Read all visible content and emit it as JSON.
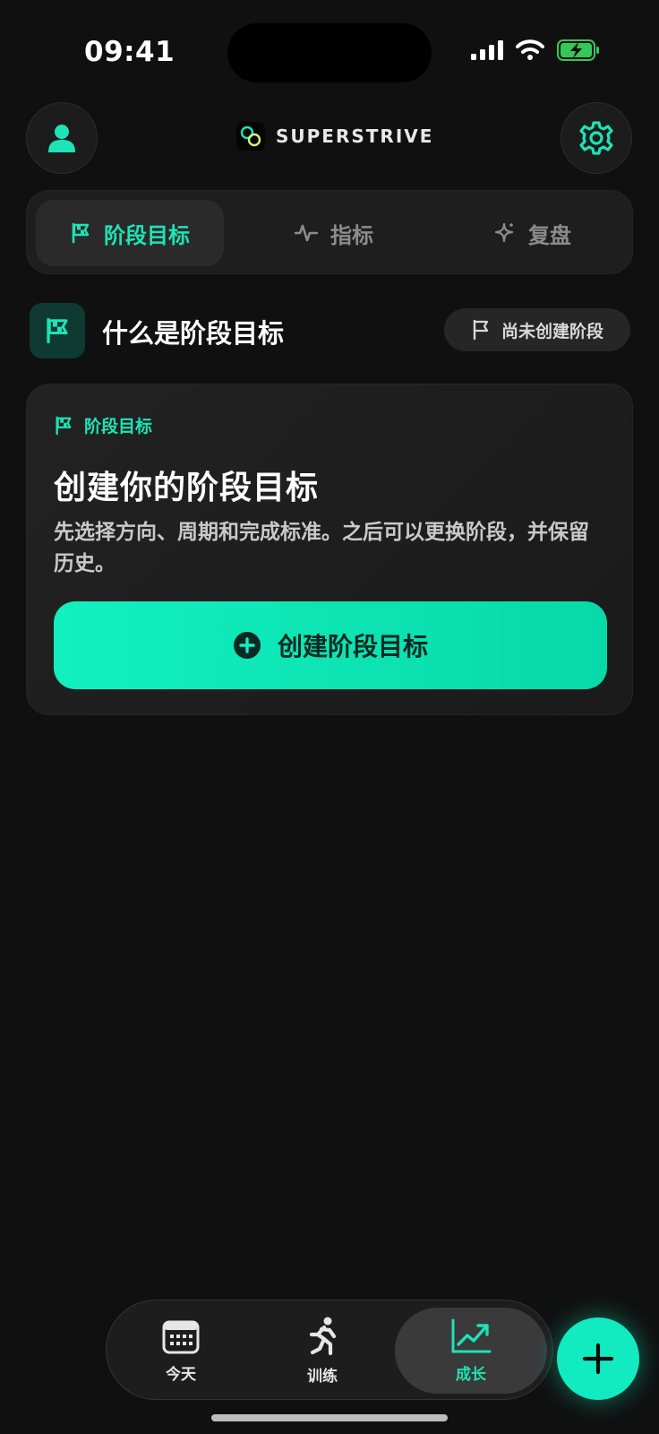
{
  "status_bar": {
    "time": "09:41"
  },
  "header": {
    "brand": "SUPERSTRIVE"
  },
  "tabs": [
    {
      "label": "阶段目标",
      "icon": "flag-checkered-icon",
      "active": true
    },
    {
      "label": "指标",
      "icon": "pulse-icon",
      "active": false
    },
    {
      "label": "复盘",
      "icon": "sparkle-icon",
      "active": false
    }
  ],
  "section": {
    "title": "什么是阶段目标",
    "badge": "尚未创建阶段"
  },
  "card": {
    "tag": "阶段目标",
    "title": "创建你的阶段目标",
    "description": "先选择方向、周期和完成标准。之后可以更换阶段，并保留历史。",
    "cta": "创建阶段目标"
  },
  "bottom_nav": [
    {
      "label": "今天",
      "icon": "calendar-icon",
      "active": false
    },
    {
      "label": "训练",
      "icon": "running-icon",
      "active": false
    },
    {
      "label": "成长",
      "icon": "chart-up-icon",
      "active": true
    }
  ],
  "colors": {
    "accent": "#1de3b6",
    "background": "#101010",
    "card": "#1e1e1e"
  }
}
